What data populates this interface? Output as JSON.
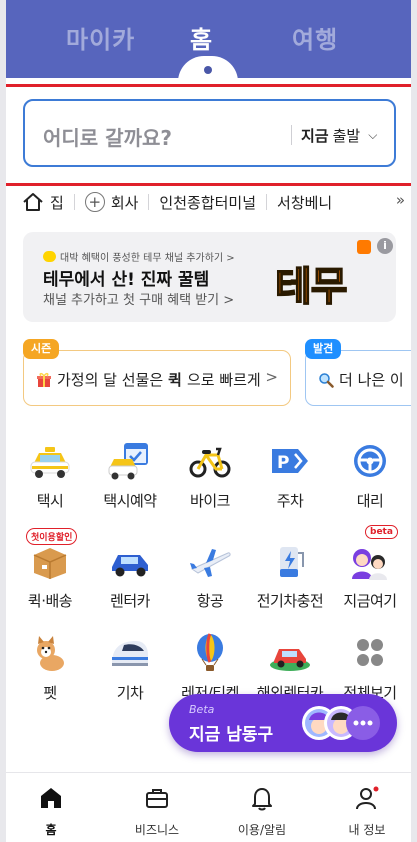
{
  "header": {
    "tabs": [
      {
        "label": "마이카"
      },
      {
        "label": "홈"
      },
      {
        "label": "여행"
      }
    ],
    "active_tab": "홈",
    "bg_color": "#5765bd"
  },
  "search": {
    "placeholder": "어디로 갈까요?",
    "time_now": "지금",
    "time_depart": "출발"
  },
  "shortcuts": {
    "items": [
      {
        "label": "집"
      },
      {
        "label": "회사"
      },
      {
        "label": "인천종합터미널"
      },
      {
        "label": "서창베니"
      }
    ],
    "more": "»"
  },
  "banner": {
    "small": "대박 혜택이 풍성한 테무 채널 추가하기 >",
    "title": "테무에서 산! 진짜 꿀템",
    "subtitle": "채널 추가하고 첫 구매 혜택 받기 >",
    "brand": "테무",
    "info": "i"
  },
  "promos": [
    {
      "tag": "시즌",
      "text_pre": "가정의 달 선물은 ",
      "text_bold": "퀵",
      "text_post": "으로 빠르게",
      "chevron": ">"
    },
    {
      "tag": "발견",
      "text": "더 나은 이"
    }
  ],
  "services": [
    {
      "label": "택시"
    },
    {
      "label": "택시예약"
    },
    {
      "label": "바이크"
    },
    {
      "label": "주차"
    },
    {
      "label": "대리"
    },
    {
      "label": "퀵·배송",
      "badge": "첫이용할인"
    },
    {
      "label": "렌터카"
    },
    {
      "label": "항공"
    },
    {
      "label": "전기차충전"
    },
    {
      "label": "지금여기",
      "badge": "beta"
    },
    {
      "label": "펫"
    },
    {
      "label": "기차"
    },
    {
      "label": "레저/티켓"
    },
    {
      "label": "해외렌터카"
    },
    {
      "label": "전체보기"
    }
  ],
  "fab": {
    "beta": "Beta",
    "text": "지금 남동구"
  },
  "bottom_nav": [
    {
      "label": "홈",
      "icon": "home-icon"
    },
    {
      "label": "비즈니스",
      "icon": "briefcase-icon"
    },
    {
      "label": "이용/알림",
      "icon": "bell-icon"
    },
    {
      "label": "내 정보",
      "icon": "person-icon"
    }
  ],
  "colors": {
    "accent": "#3d7bd6",
    "red_line": "#e0202a",
    "fab": "#6a35d9"
  }
}
